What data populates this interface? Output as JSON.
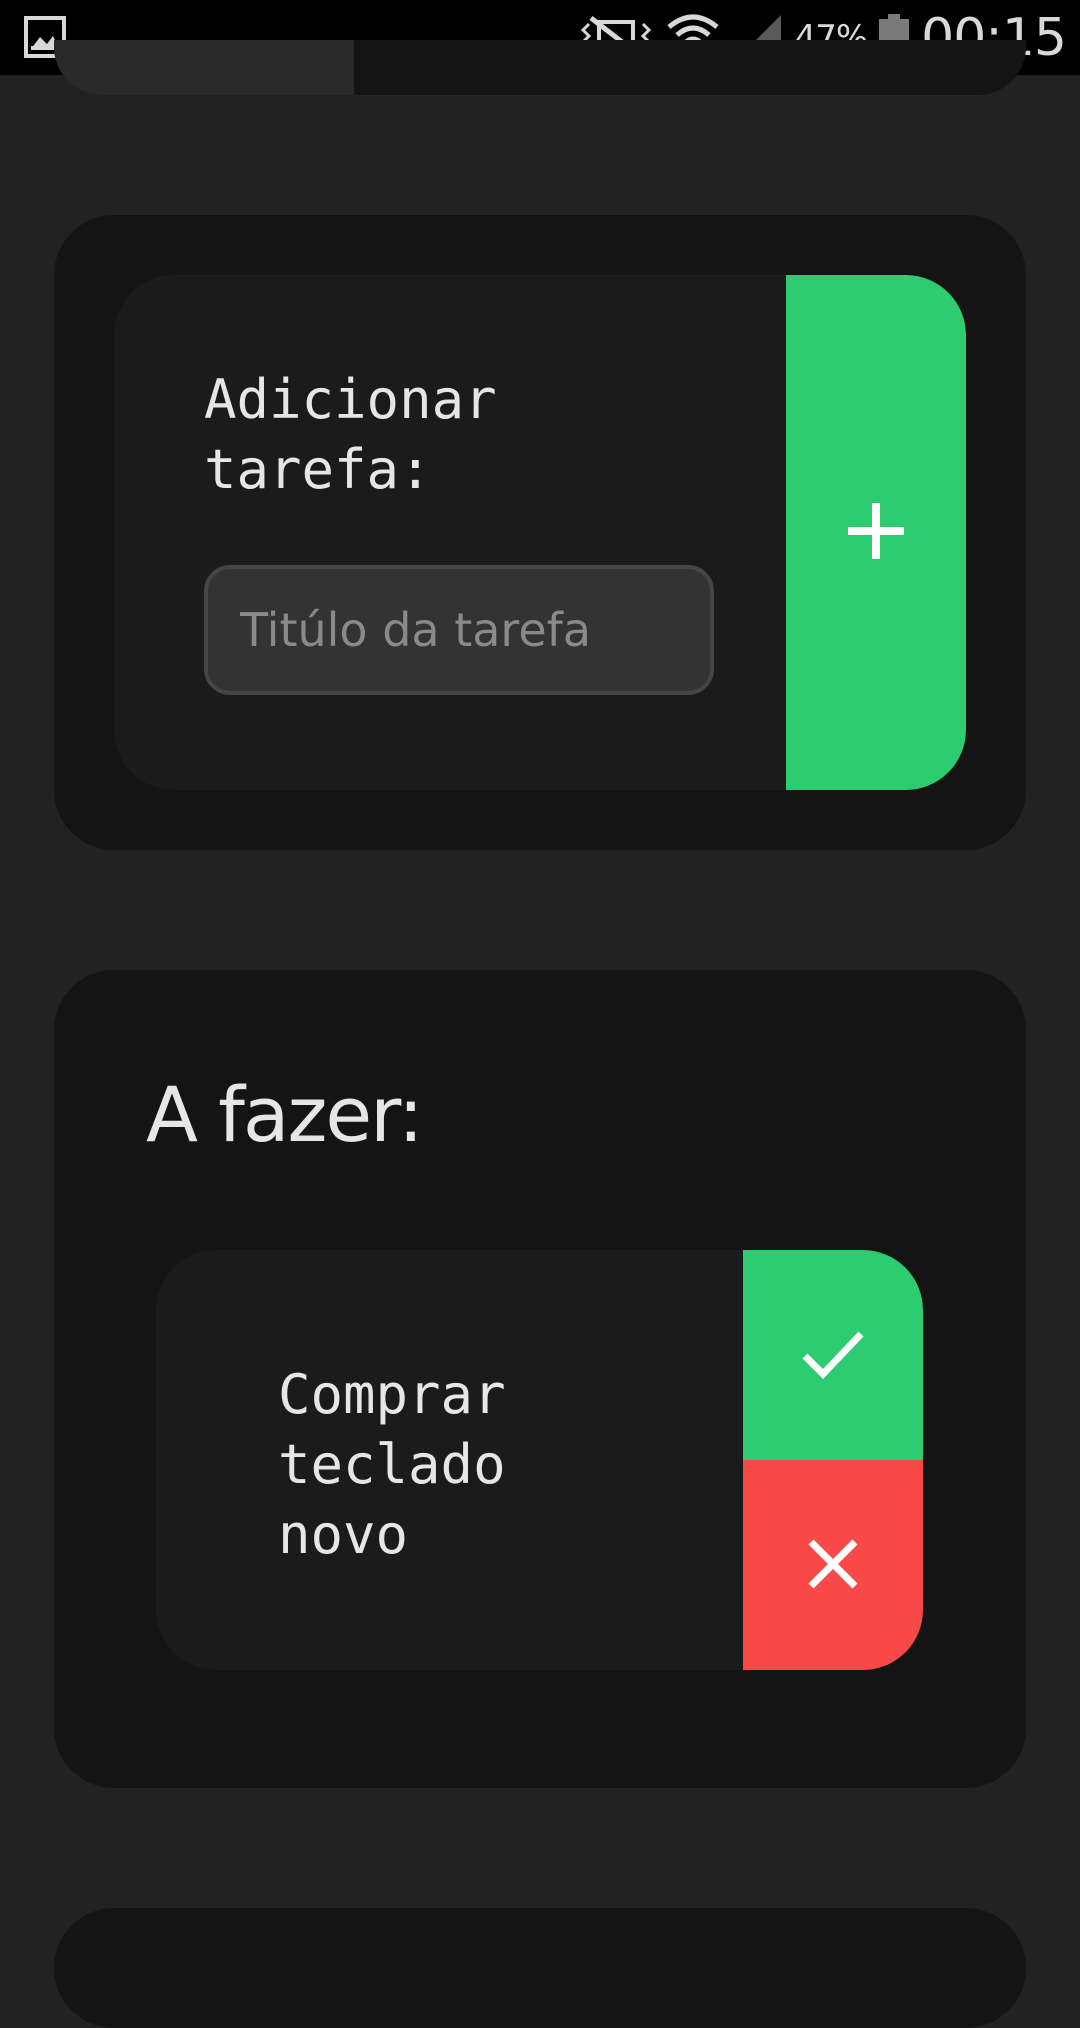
{
  "status_bar": {
    "left_icon": "gallery-icon",
    "icons": [
      "vibrate-icon",
      "wifi-icon",
      "signal-icon",
      "battery-icon"
    ],
    "battery_percent": "47%",
    "time": "00:15"
  },
  "add_task": {
    "label": "Adicionar tarefa:",
    "input_placeholder": "Titúlo da tarefa",
    "input_value": "",
    "add_button_icon": "plus-icon"
  },
  "todo": {
    "heading": "A fazer:",
    "tasks": [
      {
        "title": "Comprar teclado novo",
        "complete_icon": "check-icon",
        "delete_icon": "close-icon"
      }
    ]
  },
  "colors": {
    "background": "#222222",
    "card": "#141414",
    "panel": "#1b1b1b",
    "accent_green": "#2ecc71",
    "accent_red": "#f94848",
    "text": "#e6e6e6"
  }
}
